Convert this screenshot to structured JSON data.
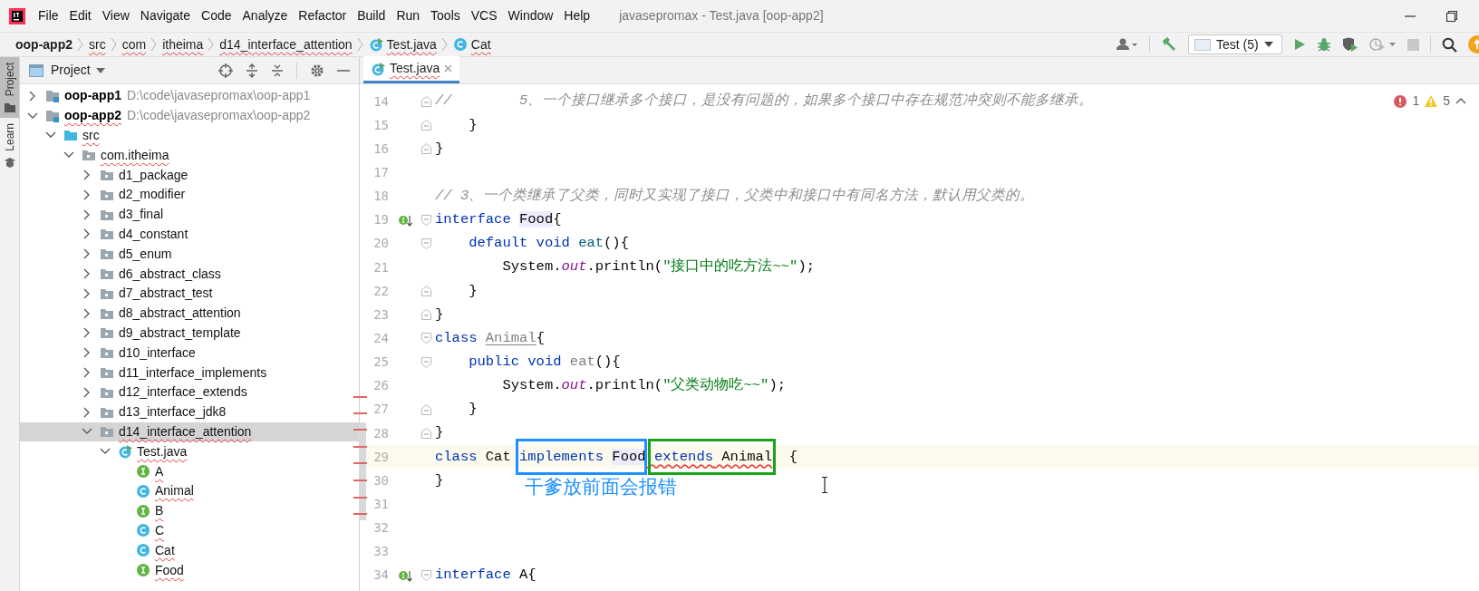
{
  "window": {
    "title": "javasepromax - Test.java [oop-app2]"
  },
  "menu": [
    "File",
    "Edit",
    "View",
    "Navigate",
    "Code",
    "Analyze",
    "Refactor",
    "Build",
    "Run",
    "Tools",
    "VCS",
    "Window",
    "Help"
  ],
  "breadcrumbs": [
    {
      "label": "oop-app2",
      "kind": "module",
      "typo": false
    },
    {
      "label": "src",
      "kind": "folder",
      "typo": true
    },
    {
      "label": "com",
      "kind": "folder",
      "typo": true
    },
    {
      "label": "itheima",
      "kind": "folder",
      "typo": true
    },
    {
      "label": "d14_interface_attention",
      "kind": "folder",
      "typo": true
    },
    {
      "label": "Test.java",
      "kind": "java-file",
      "typo": true
    },
    {
      "label": "Cat",
      "kind": "class",
      "typo": true
    }
  ],
  "run_config": {
    "label": "Test (5)"
  },
  "tool_strip": [
    {
      "label": "Project",
      "selected": true
    },
    {
      "label": "Learn",
      "selected": false
    }
  ],
  "project_panel": {
    "title": "Project",
    "tree": [
      {
        "label": "oop-app1",
        "kind": "module",
        "path": "D:\\code\\javasepromax\\oop-app1",
        "expanded": false,
        "selected": false,
        "typo": false
      },
      {
        "label": "oop-app2",
        "kind": "module",
        "path": "D:\\code\\javasepromax\\oop-app2",
        "expanded": true,
        "selected": false,
        "typo": true,
        "children": [
          {
            "label": "src",
            "kind": "source-folder",
            "expanded": true,
            "selected": false,
            "typo": true,
            "children": [
              {
                "label": "com.itheima",
                "kind": "package",
                "expanded": true,
                "selected": false,
                "typo": true,
                "children": [
                  {
                    "label": "d1_package",
                    "kind": "package",
                    "expanded": false,
                    "selected": false,
                    "typo": false
                  },
                  {
                    "label": "d2_modifier",
                    "kind": "package",
                    "expanded": false,
                    "selected": false,
                    "typo": false
                  },
                  {
                    "label": "d3_final",
                    "kind": "package",
                    "expanded": false,
                    "selected": false,
                    "typo": false
                  },
                  {
                    "label": "d4_constant",
                    "kind": "package",
                    "expanded": false,
                    "selected": false,
                    "typo": false
                  },
                  {
                    "label": "d5_enum",
                    "kind": "package",
                    "expanded": false,
                    "selected": false,
                    "typo": false
                  },
                  {
                    "label": "d6_abstract_class",
                    "kind": "package",
                    "expanded": false,
                    "selected": false,
                    "typo": false
                  },
                  {
                    "label": "d7_abstract_test",
                    "kind": "package",
                    "expanded": false,
                    "selected": false,
                    "typo": false
                  },
                  {
                    "label": "d8_abstract_attention",
                    "kind": "package",
                    "expanded": false,
                    "selected": false,
                    "typo": false
                  },
                  {
                    "label": "d9_abstract_template",
                    "kind": "package",
                    "expanded": false,
                    "selected": false,
                    "typo": false
                  },
                  {
                    "label": "d10_interface",
                    "kind": "package",
                    "expanded": false,
                    "selected": false,
                    "typo": false
                  },
                  {
                    "label": "d11_interface_implements",
                    "kind": "package",
                    "expanded": false,
                    "selected": false,
                    "typo": false
                  },
                  {
                    "label": "d12_interface_extends",
                    "kind": "package",
                    "expanded": false,
                    "selected": false,
                    "typo": false
                  },
                  {
                    "label": "d13_interface_jdk8",
                    "kind": "package",
                    "expanded": false,
                    "selected": false,
                    "typo": false
                  },
                  {
                    "label": "d14_interface_attention",
                    "kind": "package",
                    "expanded": true,
                    "selected": true,
                    "typo": true,
                    "children": [
                      {
                        "label": "Test.java",
                        "kind": "java-file",
                        "expanded": true,
                        "selected": false,
                        "typo": true,
                        "children": [
                          {
                            "label": "A",
                            "kind": "interface",
                            "selected": false,
                            "typo": true
                          },
                          {
                            "label": "Animal",
                            "kind": "class",
                            "selected": false,
                            "typo": true
                          },
                          {
                            "label": "B",
                            "kind": "interface",
                            "selected": false,
                            "typo": true
                          },
                          {
                            "label": "C",
                            "kind": "class",
                            "selected": false,
                            "typo": true
                          },
                          {
                            "label": "Cat",
                            "kind": "class",
                            "selected": false,
                            "typo": true
                          },
                          {
                            "label": "Food",
                            "kind": "interface",
                            "selected": false,
                            "typo": true
                          }
                        ]
                      }
                    ]
                  }
                ]
              }
            ]
          }
        ]
      }
    ]
  },
  "editor": {
    "tabs": [
      {
        "label": "Test.java",
        "selected": true,
        "typo": true
      }
    ],
    "problems": {
      "errors": "1",
      "warnings": "5"
    },
    "lines": [
      {
        "number": "14",
        "fold_start": false,
        "fold_end": true,
        "implemented": false,
        "current": false,
        "tokens": [
          {
            "kind": "comment",
            "text": "//        5、一个接口继承多个接口，是没有问题的，如果多个接口中存在规范冲突则不能多继承。"
          }
        ]
      },
      {
        "number": "15",
        "fold_start": false,
        "fold_end": true,
        "implemented": false,
        "current": false,
        "tokens": [
          {
            "kind": "plain",
            "text": "    }"
          }
        ]
      },
      {
        "number": "16",
        "fold_start": false,
        "fold_end": true,
        "implemented": false,
        "current": false,
        "tokens": [
          {
            "kind": "plain",
            "text": "}"
          }
        ]
      },
      {
        "number": "17",
        "fold_start": false,
        "fold_end": false,
        "implemented": false,
        "current": false
      },
      {
        "number": "18",
        "fold_start": false,
        "fold_end": false,
        "implemented": false,
        "current": false,
        "tokens": [
          {
            "kind": "comment",
            "text": "// 3、一个类继承了父类，同时又实现了接口，父类中和接口中有同名方法，默认用父类的。"
          }
        ]
      },
      {
        "number": "19",
        "fold_start": true,
        "fold_end": false,
        "implemented": true,
        "current": false,
        "tokens": [
          {
            "kind": "keyword",
            "text": "interface "
          },
          {
            "kind": "highlight",
            "text": "Food"
          },
          {
            "kind": "plain",
            "text": "{"
          }
        ]
      },
      {
        "number": "20",
        "fold_start": true,
        "fold_end": false,
        "implemented": false,
        "current": false,
        "tokens": [
          {
            "kind": "keyword",
            "text": "    default void "
          },
          {
            "kind": "method",
            "text": "eat"
          },
          {
            "kind": "plain",
            "text": "(){"
          }
        ]
      },
      {
        "number": "21",
        "fold_start": false,
        "fold_end": false,
        "implemented": false,
        "current": false,
        "tokens": [
          {
            "kind": "plain",
            "text": "        System."
          },
          {
            "kind": "static",
            "text": "out"
          },
          {
            "kind": "plain",
            "text": ".println("
          },
          {
            "kind": "string",
            "text": "\"接口中的吃方法~~\""
          },
          {
            "kind": "plain",
            "text": ");"
          }
        ]
      },
      {
        "number": "22",
        "fold_start": false,
        "fold_end": true,
        "implemented": false,
        "current": false,
        "tokens": [
          {
            "kind": "plain",
            "text": "    }"
          }
        ]
      },
      {
        "number": "23",
        "fold_start": false,
        "fold_end": true,
        "implemented": false,
        "current": false,
        "tokens": [
          {
            "kind": "plain",
            "text": "}"
          }
        ]
      },
      {
        "number": "24",
        "fold_start": true,
        "fold_end": false,
        "implemented": false,
        "current": false,
        "tokens": [
          {
            "kind": "keyword",
            "text": "class "
          },
          {
            "kind": "unused-class",
            "text": "Animal"
          },
          {
            "kind": "plain",
            "text": "{"
          }
        ]
      },
      {
        "number": "25",
        "fold_start": true,
        "fold_end": false,
        "implemented": false,
        "current": false,
        "tokens": [
          {
            "kind": "keyword",
            "text": "    public void "
          },
          {
            "kind": "unused",
            "text": "eat"
          },
          {
            "kind": "plain",
            "text": "(){"
          }
        ]
      },
      {
        "number": "26",
        "fold_start": false,
        "fold_end": false,
        "implemented": false,
        "current": false,
        "tokens": [
          {
            "kind": "plain",
            "text": "        System."
          },
          {
            "kind": "static",
            "text": "out"
          },
          {
            "kind": "plain",
            "text": ".println("
          },
          {
            "kind": "string",
            "text": "\"父类动物吃~~\""
          },
          {
            "kind": "plain",
            "text": ");"
          }
        ]
      },
      {
        "number": "27",
        "fold_start": false,
        "fold_end": true,
        "implemented": false,
        "current": false,
        "tokens": [
          {
            "kind": "plain",
            "text": "    }"
          }
        ]
      },
      {
        "number": "28",
        "fold_start": false,
        "fold_end": true,
        "implemented": false,
        "current": false,
        "tokens": [
          {
            "kind": "plain",
            "text": "}"
          }
        ]
      },
      {
        "number": "29",
        "fold_start": false,
        "fold_end": false,
        "implemented": false,
        "current": true,
        "tokens": [
          {
            "kind": "keyword",
            "text": "class"
          },
          {
            "kind": "plain",
            "text": " Cat "
          },
          {
            "kind": "framed",
            "color": "#1e90ff",
            "error": false,
            "tokens": [
              {
                "kind": "keyword",
                "text": "implements "
              },
              {
                "kind": "highlight",
                "text": "Food"
              }
            ]
          },
          {
            "kind": "framed",
            "color": "#1aa31a",
            "error": true,
            "tokens": [
              {
                "kind": "keyword",
                "text": " extends"
              },
              {
                "kind": "plain",
                "text": " Animal"
              }
            ]
          },
          {
            "kind": "plain",
            "text": "  {"
          }
        ]
      },
      {
        "number": "30",
        "fold_start": false,
        "fold_end": false,
        "implemented": false,
        "current": false,
        "tokens": [
          {
            "kind": "plain",
            "text": "}"
          }
        ]
      },
      {
        "number": "31",
        "fold_start": false,
        "fold_end": false,
        "implemented": false,
        "current": false
      },
      {
        "number": "32",
        "fold_start": false,
        "fold_end": false,
        "implemented": false,
        "current": false
      },
      {
        "number": "33",
        "fold_start": false,
        "fold_end": false,
        "implemented": false,
        "current": false
      },
      {
        "number": "34",
        "fold_start": true,
        "fold_end": false,
        "implemented": true,
        "current": false,
        "tokens": [
          {
            "kind": "keyword",
            "text": "interface"
          },
          {
            "kind": "plain",
            "text": " A{"
          }
        ]
      }
    ],
    "annotation": "干爹放前面会报错"
  }
}
